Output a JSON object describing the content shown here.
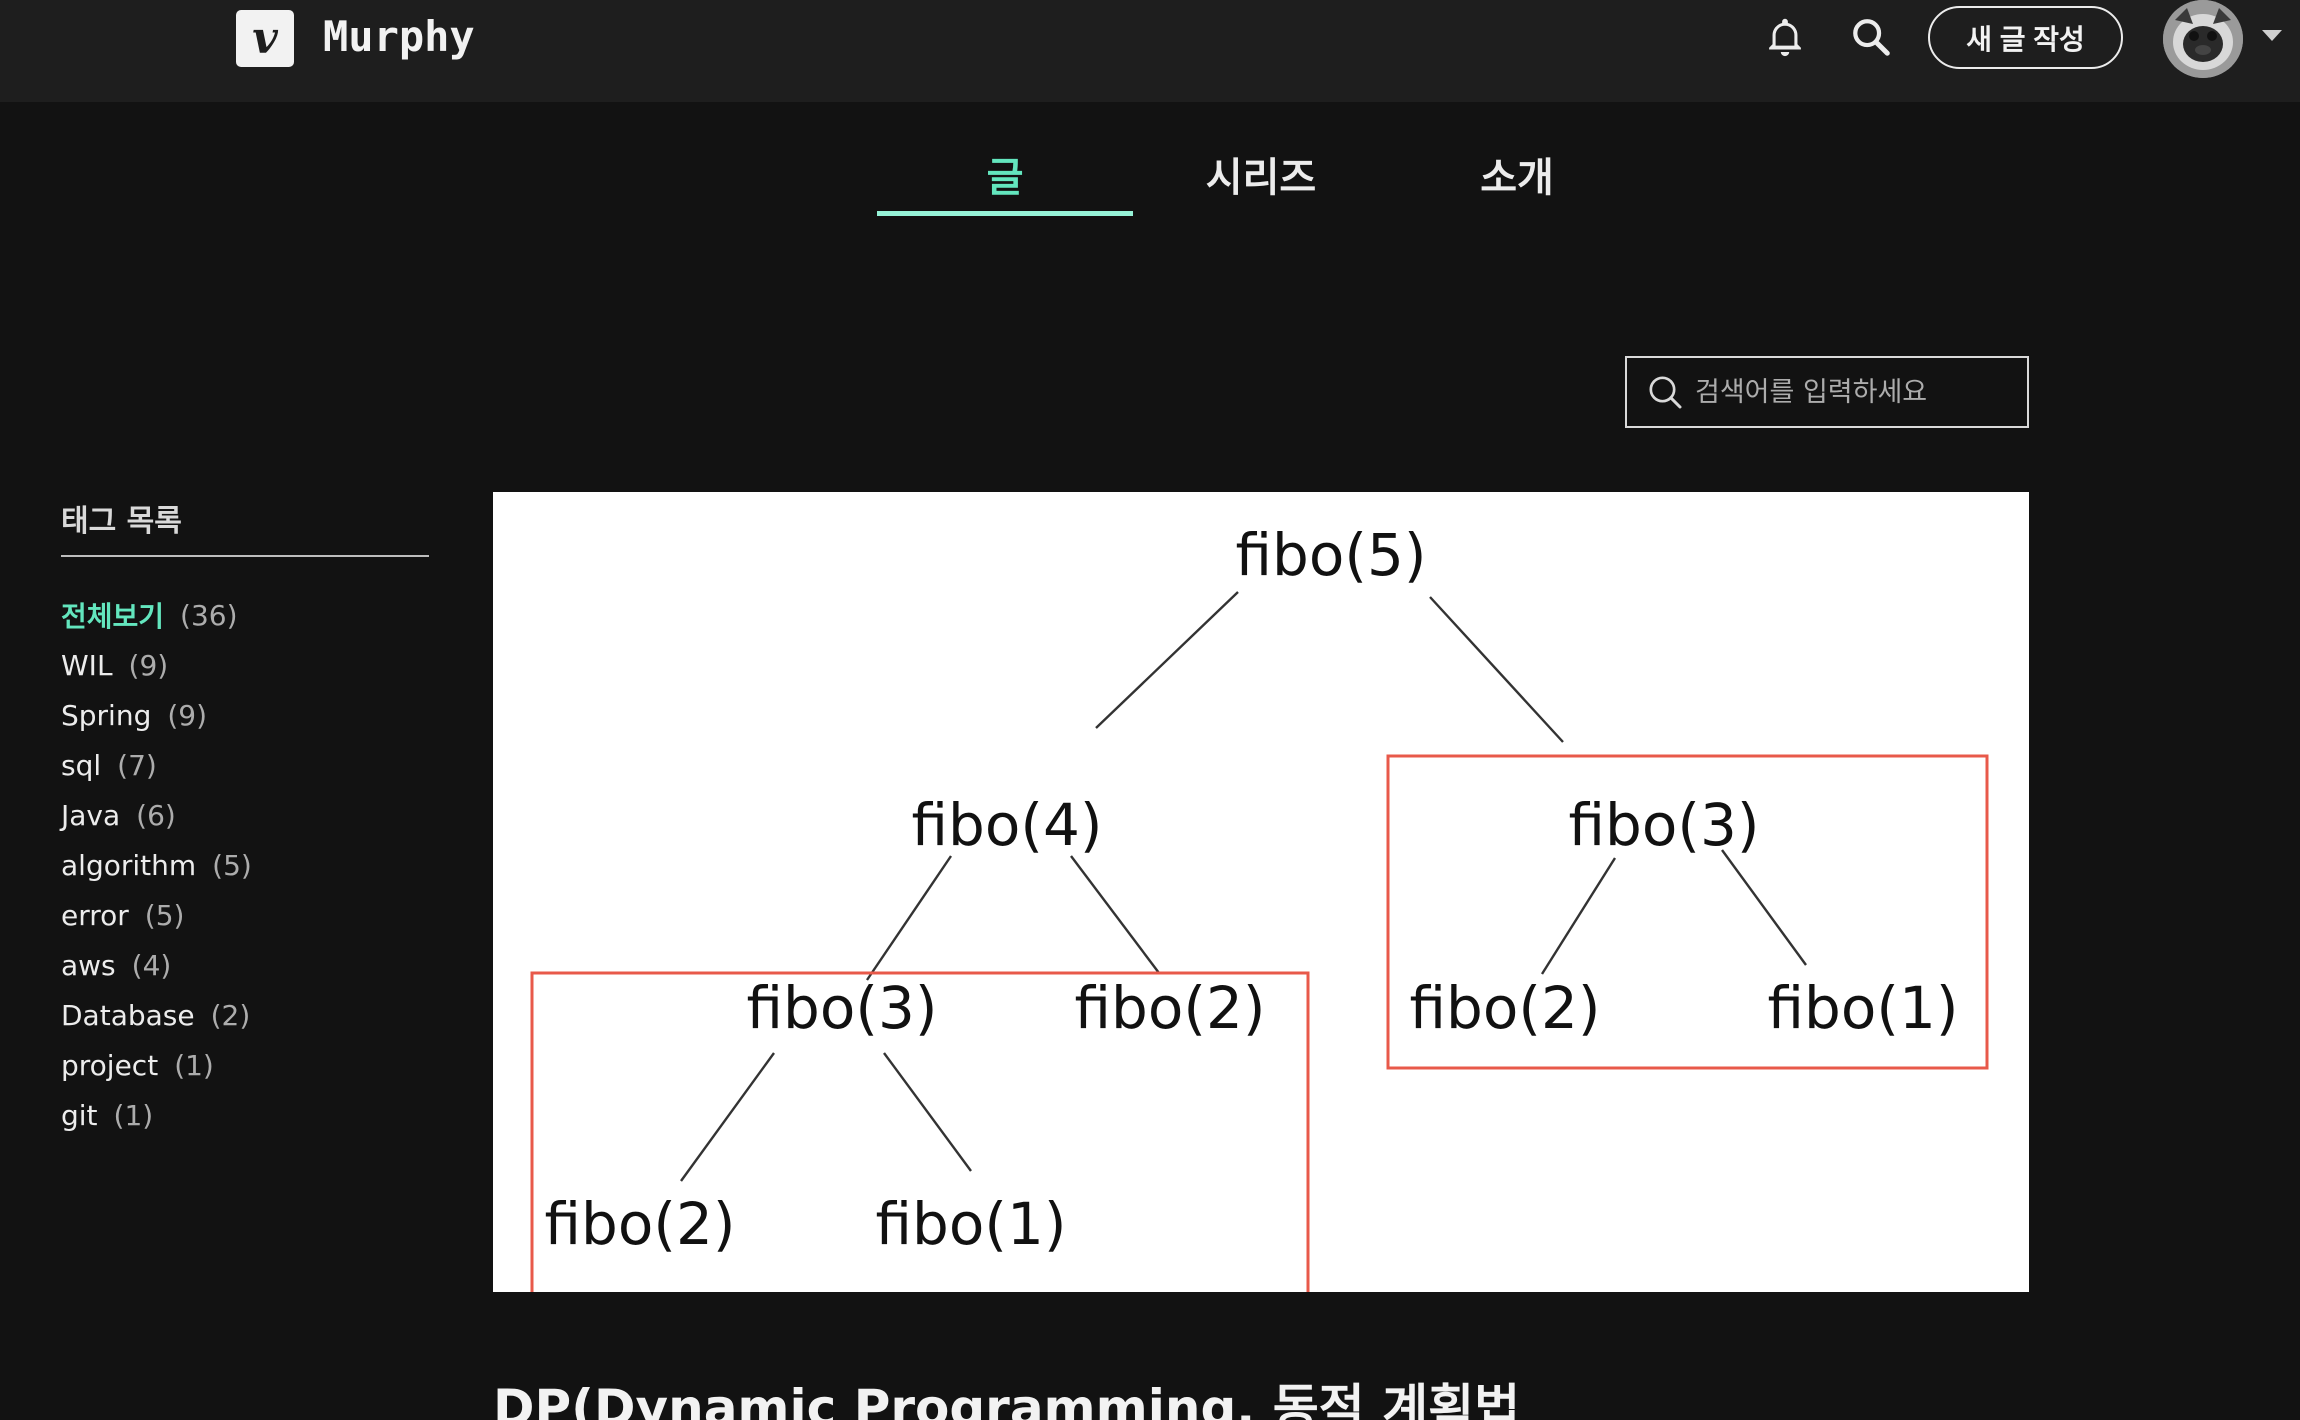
{
  "header": {
    "logo_letter": "v",
    "blog_name": "Murphy",
    "write_button": "새 글 작성",
    "icons": [
      "bell-icon",
      "search-icon",
      "avatar",
      "caret-down-icon"
    ]
  },
  "tabs": [
    {
      "label": "글",
      "active": true
    },
    {
      "label": "시리즈",
      "active": false
    },
    {
      "label": "소개",
      "active": false
    }
  ],
  "search": {
    "placeholder": "검색어를 입력하세요",
    "value": ""
  },
  "tags": {
    "title": "태그 목록",
    "items": [
      {
        "name": "전체보기",
        "count": "(36)",
        "active": true
      },
      {
        "name": "WIL",
        "count": "(9)"
      },
      {
        "name": "Spring",
        "count": "(9)"
      },
      {
        "name": "sql",
        "count": "(7)"
      },
      {
        "name": "Java",
        "count": "(6)"
      },
      {
        "name": "algorithm",
        "count": "(5)"
      },
      {
        "name": "error",
        "count": "(5)"
      },
      {
        "name": "aws",
        "count": "(4)"
      },
      {
        "name": "Database",
        "count": "(2)"
      },
      {
        "name": "project",
        "count": "(1)"
      },
      {
        "name": "git",
        "count": "(1)"
      }
    ]
  },
  "thumbnail": {
    "nodes": {
      "root": "fibo(5)",
      "l": "fibo(4)",
      "r": "fibo(3)",
      "ll": "fibo(3)",
      "lr": "fibo(2)",
      "rl": "fibo(2)",
      "rr": "fibo(1)",
      "lll": "fibo(2)",
      "llr": "fibo(1)"
    },
    "highlight_color": "#e8594a"
  },
  "post": {
    "title": "DP(Dynamic Programming, 동적 계획법"
  },
  "colors": {
    "accent": "#63e6be",
    "background": "#121212",
    "header": "#1e1e1e"
  }
}
